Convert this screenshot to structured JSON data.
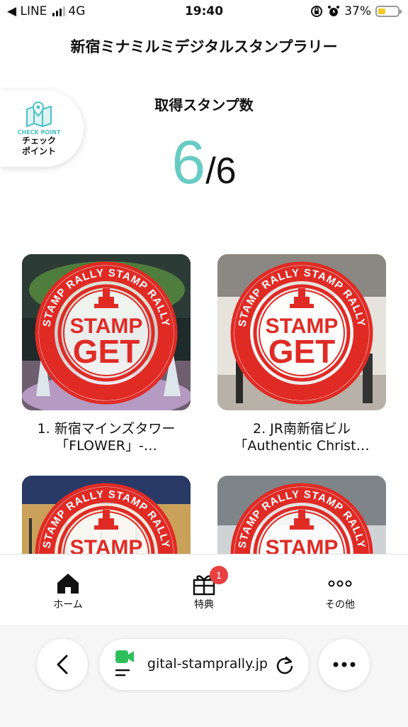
{
  "status_bar": {
    "carrier": "◀ LINE",
    "network": "4G",
    "time": "19:40",
    "battery": "37%",
    "battery_level": 0.37
  },
  "header": {
    "title": "新宿ミナミルミデジタルスタンプラリー"
  },
  "checkpoint": {
    "icon": "map-pin-icon",
    "en": "CHECK POINT",
    "jp_line1": "チェック",
    "jp_line2": "ポイント"
  },
  "stamps": {
    "label": "取得スタンプ数",
    "current": "6",
    "total": "/6"
  },
  "stamp_badge": {
    "ring_top": "STAMP RALLY STAMP RALLY",
    "ring_bottom": "STAMP RALLY STAMP RALLY",
    "line1": "STAMP",
    "line2": "GET"
  },
  "cards": [
    {
      "title": "1. 新宿マインズタワー「FLOWER」-…"
    },
    {
      "title": "2. JR南新宿ビル　「Authentic Christ…"
    },
    {
      "title": ""
    },
    {
      "title": ""
    }
  ],
  "bottom_nav": {
    "items": [
      {
        "label": "ホーム",
        "icon": "home-icon"
      },
      {
        "label": "特典",
        "icon": "gift-icon",
        "badge": "1"
      },
      {
        "label": "その他",
        "icon": "more-icon"
      }
    ]
  },
  "browser": {
    "url": "digital-stamprally.jp"
  },
  "colors": {
    "accent": "#66ccc4",
    "stamp_red": "#e02b25",
    "badge_red": "#e84040"
  }
}
